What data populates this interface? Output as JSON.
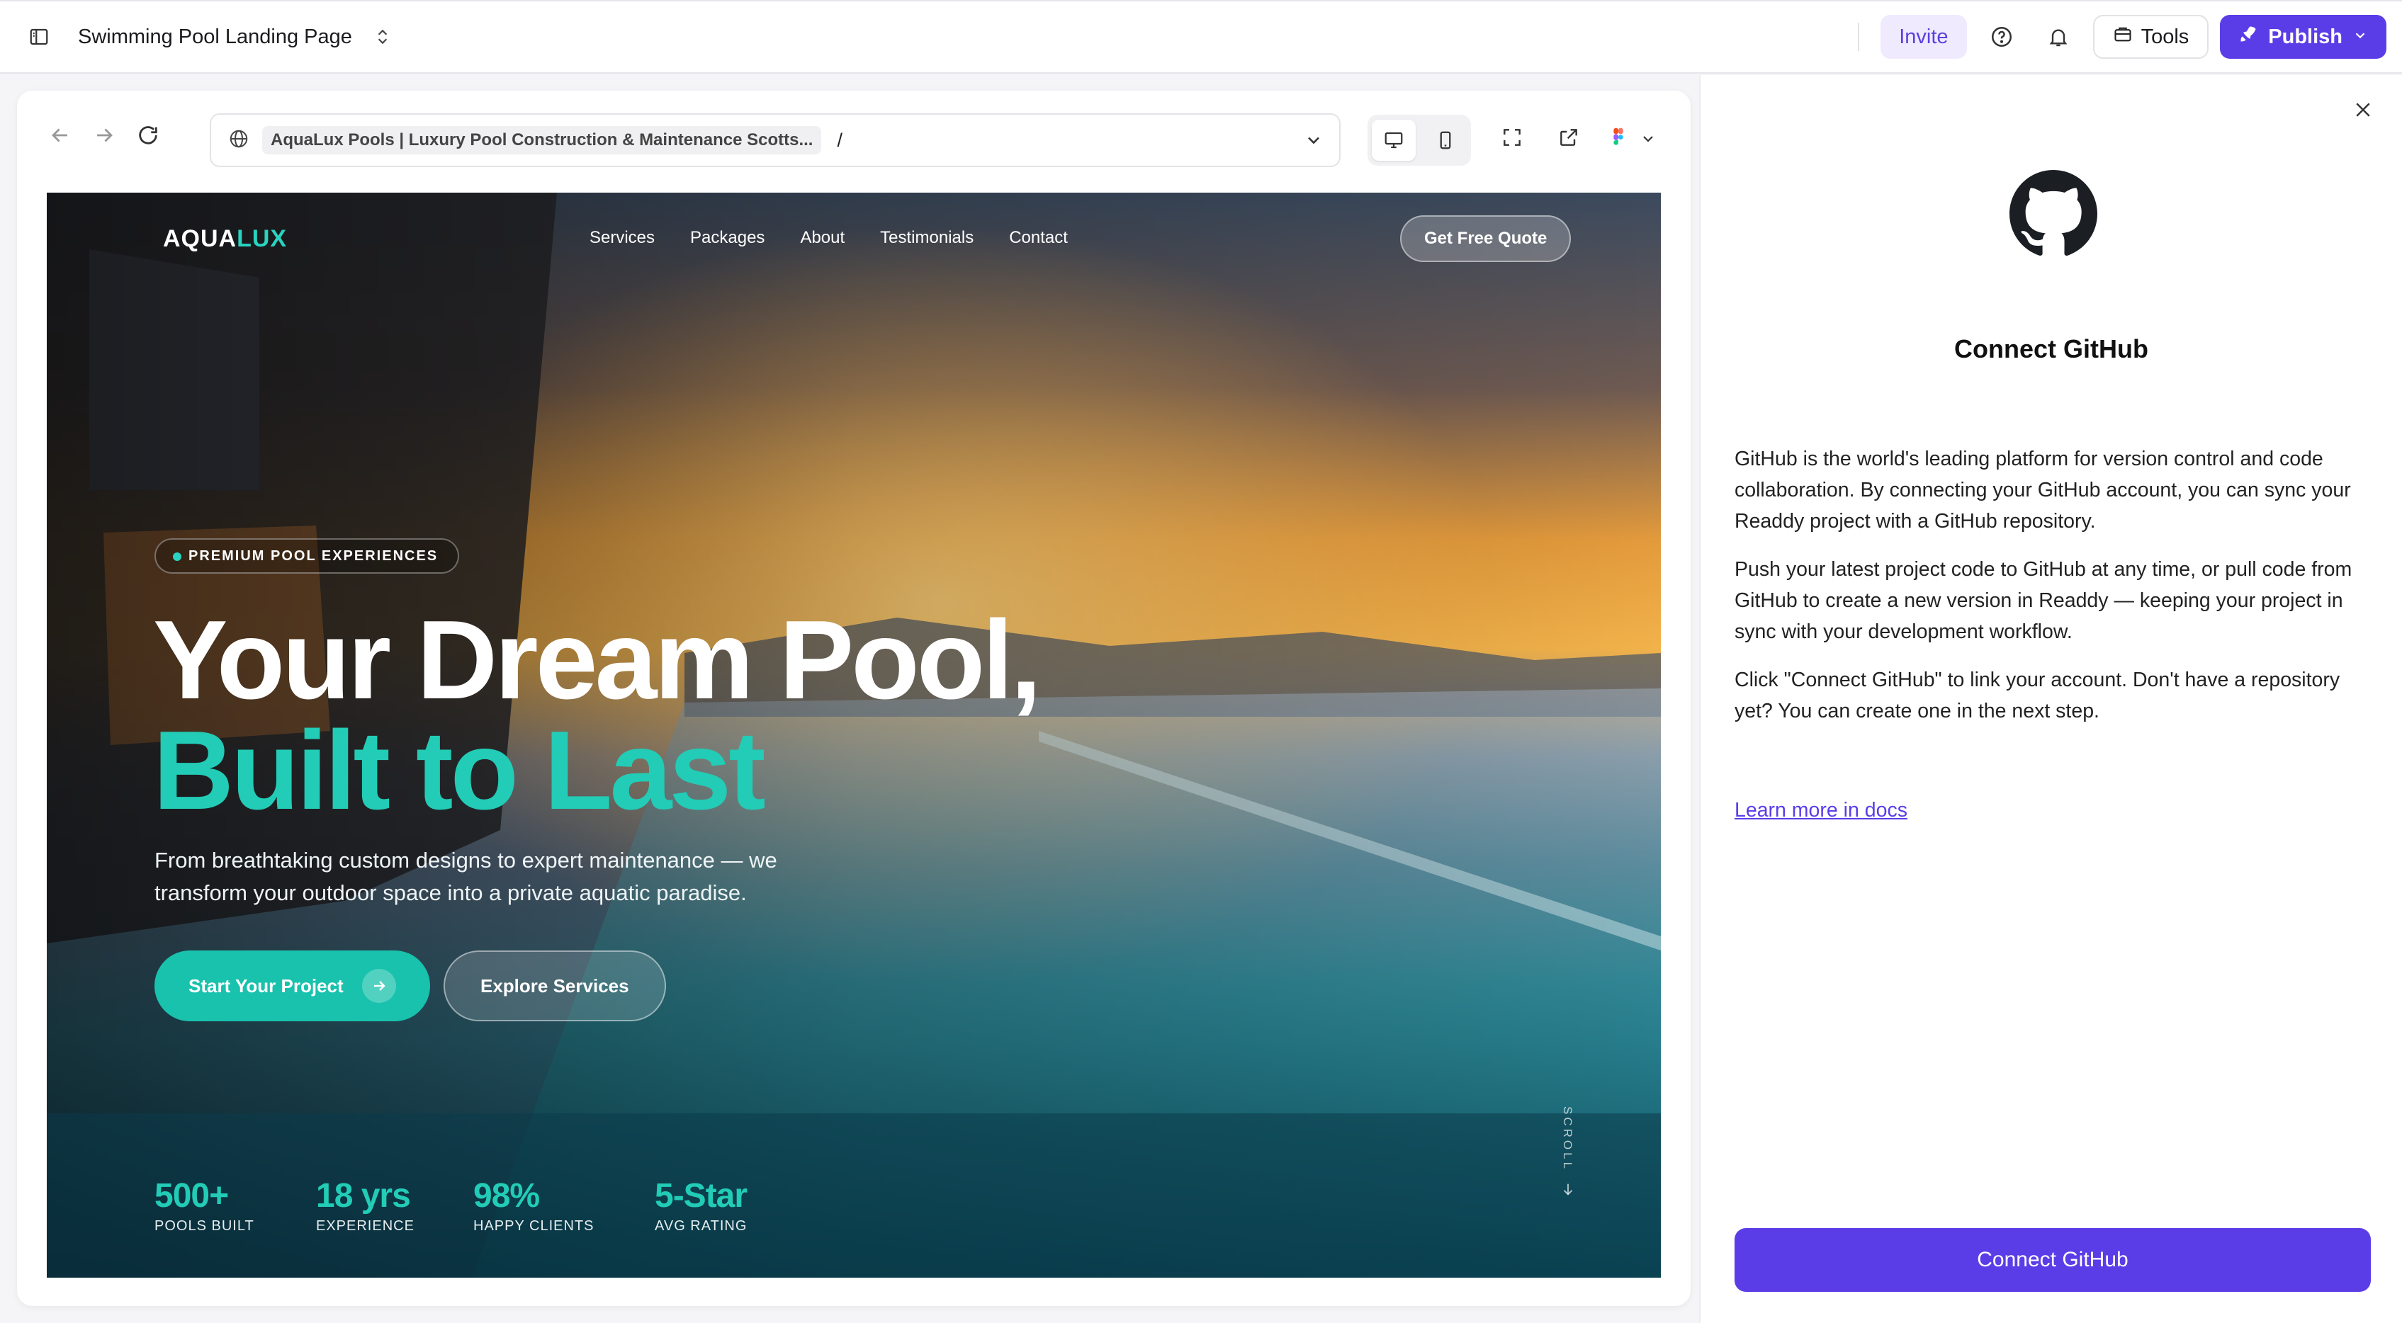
{
  "topbar": {
    "project_title": "Swimming Pool Landing Page",
    "invite_label": "Invite",
    "tools_label": "Tools",
    "publish_label": "Publish"
  },
  "browser": {
    "page_title": "AquaLux Pools | Luxury Pool Construction & Maintenance Scotts...",
    "path": "/"
  },
  "site": {
    "logo_main": "AQUA",
    "logo_accent": "LUX",
    "nav": [
      "Services",
      "Packages",
      "About",
      "Testimonials",
      "Contact"
    ],
    "quote_button": "Get Free Quote",
    "badge": "PREMIUM POOL EXPERIENCES",
    "headline_1": "Your Dream Pool,",
    "headline_2": "Built to Last",
    "lead": "From breathtaking custom designs to expert maintenance — we transform your outdoor space into a private aquatic paradise.",
    "cta_primary": "Start Your Project",
    "cta_secondary": "Explore Services",
    "stats": [
      {
        "value": "500+",
        "label": "POOLS BUILT"
      },
      {
        "value": "18 yrs",
        "label": "EXPERIENCE"
      },
      {
        "value": "98%",
        "label": "HAPPY CLIENTS"
      },
      {
        "value": "5-Star",
        "label": "AVG RATING"
      }
    ],
    "scroll_label": "SCROLL"
  },
  "panel": {
    "title": "Connect GitHub",
    "paragraphs": [
      "GitHub is the world's leading platform for version control and code collaboration. By connecting your GitHub account, you can sync your Readdy project with a GitHub repository.",
      "Push your latest project code to GitHub at any time, or pull code from GitHub to create a new version in Readdy — keeping your project in sync with your development workflow.",
      "Click \"Connect GitHub\" to link your account. Don't have a repository yet? You can create one in the next step."
    ],
    "docs_link": "Learn more in docs",
    "connect_button": "Connect GitHub"
  },
  "colors": {
    "brand": "#5b3de8",
    "teal": "#22ccb6"
  },
  "icons": [
    "sidebar-toggle-icon",
    "chevron-up-down-icon",
    "help-icon",
    "bell-icon",
    "tools-icon",
    "rocket-icon",
    "chevron-down-icon",
    "back-arrow-icon",
    "forward-arrow-icon",
    "reload-icon",
    "globe-icon",
    "desktop-icon",
    "mobile-icon",
    "fullscreen-icon",
    "external-link-icon",
    "figma-icon",
    "close-icon",
    "github-icon",
    "arrow-right-icon",
    "arrow-down-icon"
  ]
}
